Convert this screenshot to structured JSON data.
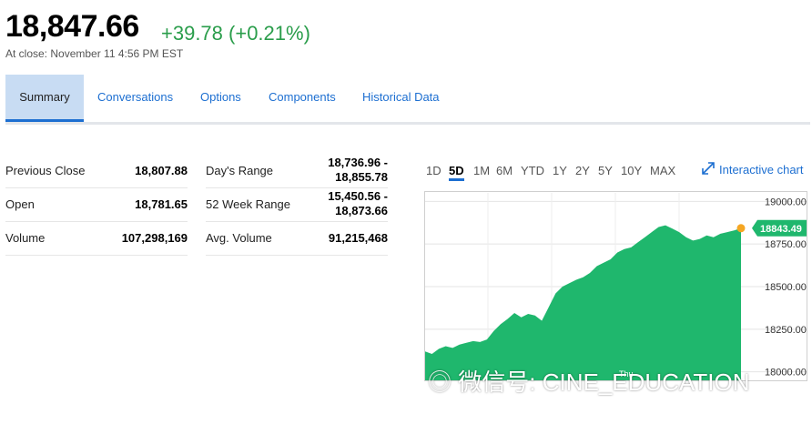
{
  "quote": {
    "price": "18,847.66",
    "change": "+39.78 (+0.21%)",
    "close_time": "At close: November 11 4:56 PM EST"
  },
  "tabs": [
    "Summary",
    "Conversations",
    "Options",
    "Components",
    "Historical Data"
  ],
  "stats_left": [
    {
      "label": "Previous Close",
      "value": "18,807.88"
    },
    {
      "label": "Open",
      "value": "18,781.65"
    },
    {
      "label": "Volume",
      "value": "107,298,169"
    }
  ],
  "stats_right": [
    {
      "label": "Day's Range",
      "value1": "18,736.96 -",
      "value2": "18,855.78"
    },
    {
      "label": "52 Week Range",
      "value1": "15,450.56 -",
      "value2": "18,873.66"
    },
    {
      "label": "Avg. Volume",
      "value1": "91,215,468",
      "value2": ""
    }
  ],
  "ranges": [
    "1D",
    "5D",
    "1M",
    "6M",
    "YTD",
    "1Y",
    "2Y",
    "5Y",
    "10Y",
    "MAX"
  ],
  "active_range": "5D",
  "interactive_chart": "Interactive chart",
  "chart_data": {
    "type": "area",
    "y_ticks": [
      "19000.00",
      "18750.00",
      "18500.00",
      "18250.00",
      "18000.00"
    ],
    "ylim": [
      17950,
      19050
    ],
    "x_tick": "Thu",
    "current_label": "18843.49",
    "series_color": "#1fb76d",
    "values": [
      18120,
      18105,
      18135,
      18150,
      18140,
      18160,
      18170,
      18180,
      18175,
      18190,
      18240,
      18280,
      18310,
      18345,
      18320,
      18340,
      18330,
      18300,
      18380,
      18460,
      18500,
      18520,
      18540,
      18555,
      18580,
      18620,
      18640,
      18660,
      18700,
      18720,
      18730,
      18760,
      18790,
      18820,
      18850,
      18860,
      18840,
      18820,
      18790,
      18770,
      18780,
      18800,
      18790,
      18810,
      18820,
      18830,
      18843
    ]
  },
  "watermark": "微信号: CINE_EDUCATION",
  "colors": {
    "accent": "#1d6fd1",
    "up": "#2a9d4b",
    "marker": "#f5a623"
  }
}
